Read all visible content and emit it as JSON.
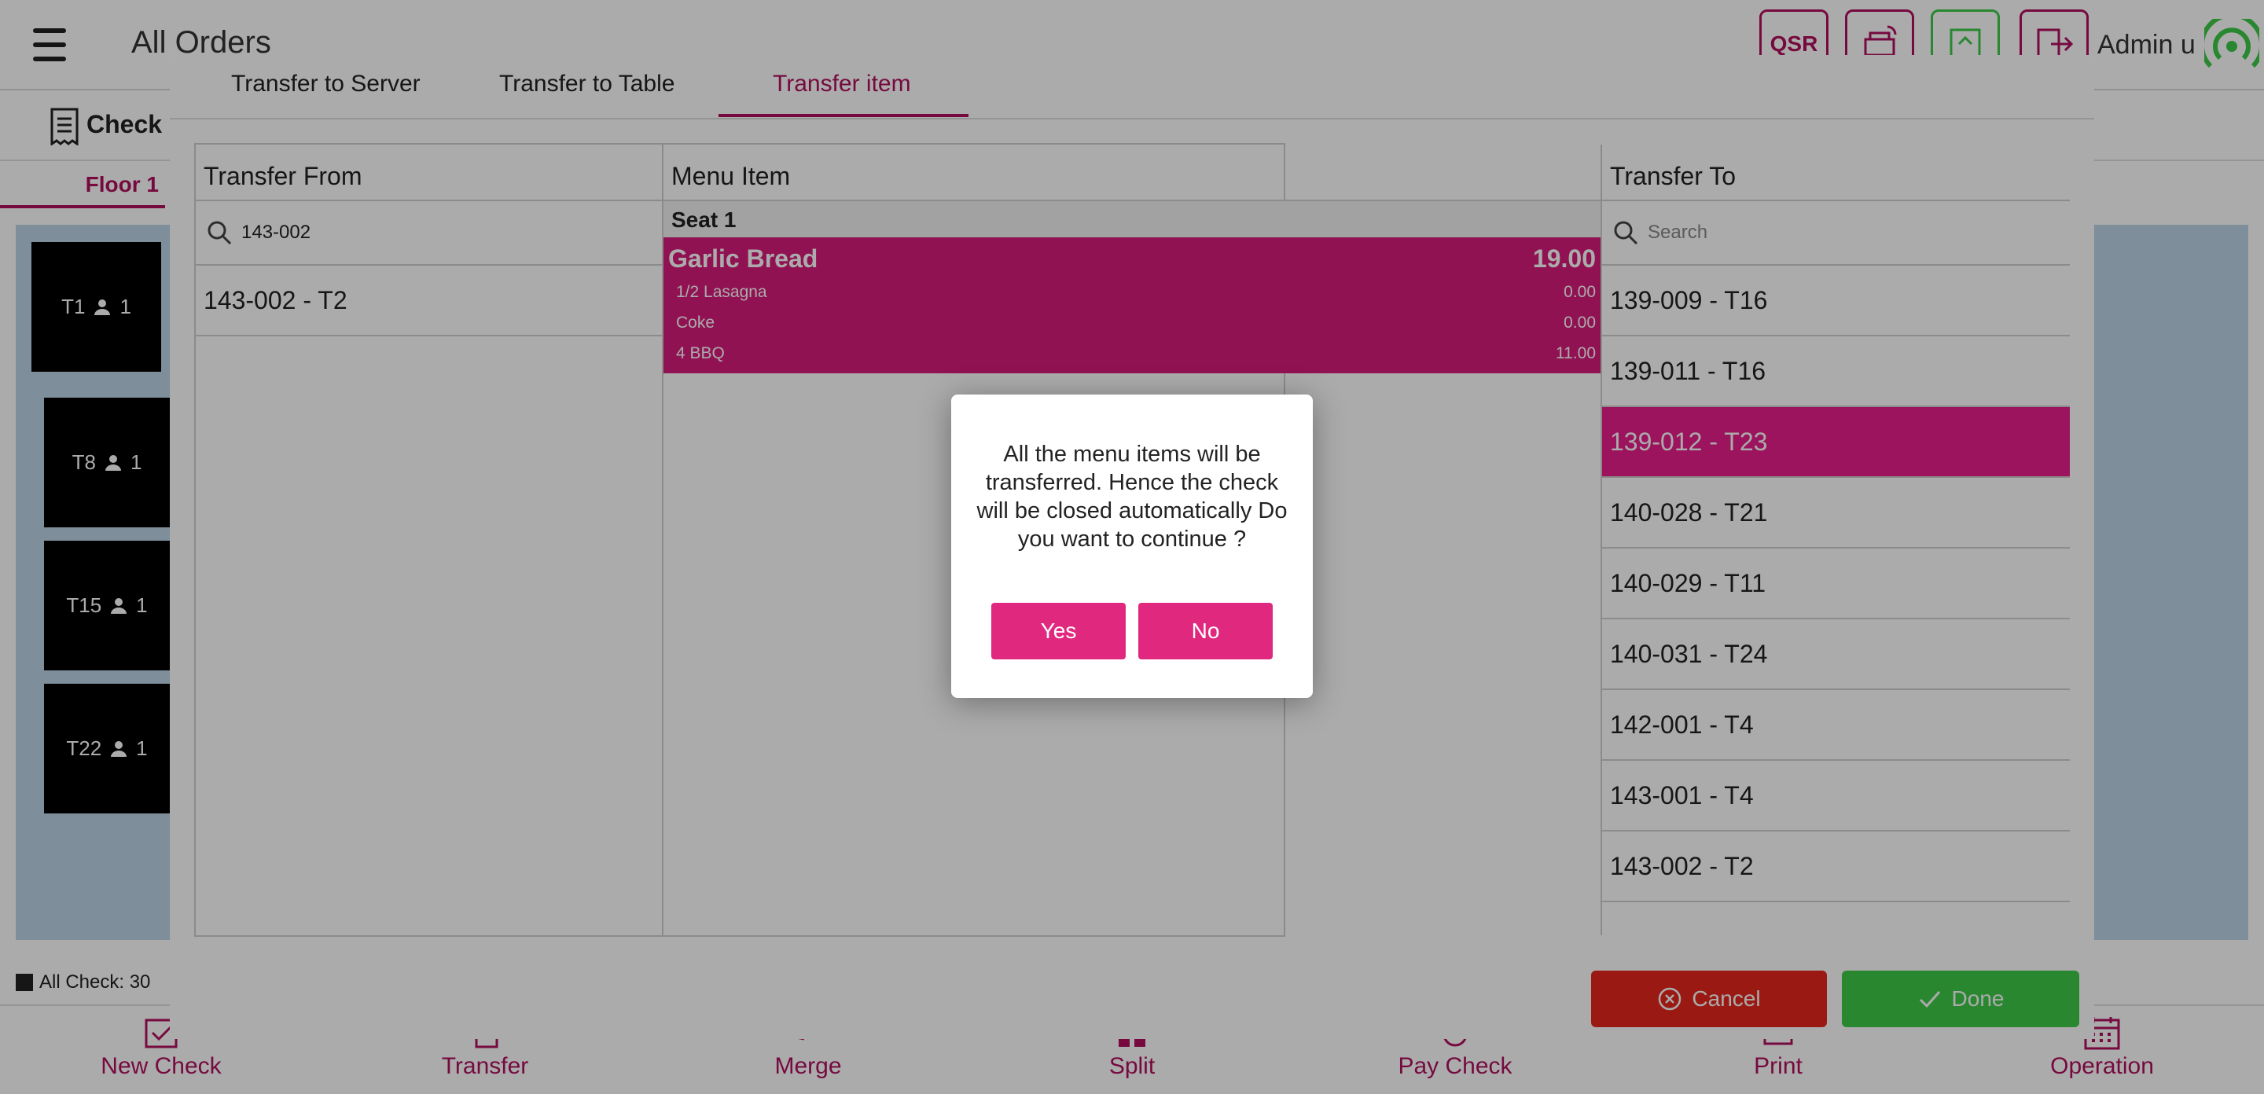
{
  "app": {
    "title": "All Orders",
    "qsr_label": "QSR",
    "admin_label": "Admin u",
    "check_label": "Check S",
    "floor_tab": "Floor 1",
    "all_check": "All Check: 30"
  },
  "tables": [
    {
      "label": "T1",
      "guests": "1"
    },
    {
      "label": "T8",
      "guests": "1"
    },
    {
      "label": "T15",
      "guests": "1"
    },
    {
      "label": "T22",
      "guests": "1"
    }
  ],
  "bottom_nav": [
    {
      "label": "New Check",
      "icon": "new-check-icon"
    },
    {
      "label": "Transfer",
      "icon": "transfer-icon"
    },
    {
      "label": "Merge",
      "icon": "merge-icon"
    },
    {
      "label": "Split",
      "icon": "split-icon"
    },
    {
      "label": "Pay Check",
      "icon": "pay-check-icon"
    },
    {
      "label": "Print",
      "icon": "print-icon"
    },
    {
      "label": "Operation",
      "icon": "calendar-icon"
    }
  ],
  "modal": {
    "tabs": [
      "Transfer to Server",
      "Transfer to Table",
      "Transfer item"
    ],
    "active_tab": "Transfer item",
    "from": {
      "header": "Transfer From",
      "search_value": "143-002",
      "items": [
        "143-002 - T2"
      ]
    },
    "menu": {
      "header": "Menu Item",
      "seat": "Seat 1",
      "item": {
        "name": "Garlic Bread",
        "price": "19.00"
      },
      "modifiers": [
        {
          "name": "1/2 Lasagna",
          "price": "0.00"
        },
        {
          "name": "Coke",
          "price": "0.00"
        },
        {
          "name": "4 BBQ",
          "price": "11.00"
        }
      ]
    },
    "to": {
      "header": "Transfer To",
      "search_placeholder": "Search",
      "items": [
        "139-009 - T16",
        "139-011 - T16",
        "139-012 - T23",
        "140-028 - T21",
        "140-029 - T11",
        "140-031 - T24",
        "142-001 - T4",
        "143-001 - T4",
        "143-002 - T2"
      ],
      "selected": "139-012 - T23"
    },
    "cancel_label": "Cancel",
    "done_label": "Done"
  },
  "confirm": {
    "message": "All the menu items will be transferred. Hence the check will be closed automatically Do you want to continue ?",
    "yes_label": "Yes",
    "no_label": "No"
  },
  "colors": {
    "accent": "#b0105f",
    "selected_pink": "#e91e8c",
    "cancel_red": "#e7261d",
    "done_green": "#3ec948",
    "floor_blue": "#bcd4e6"
  }
}
